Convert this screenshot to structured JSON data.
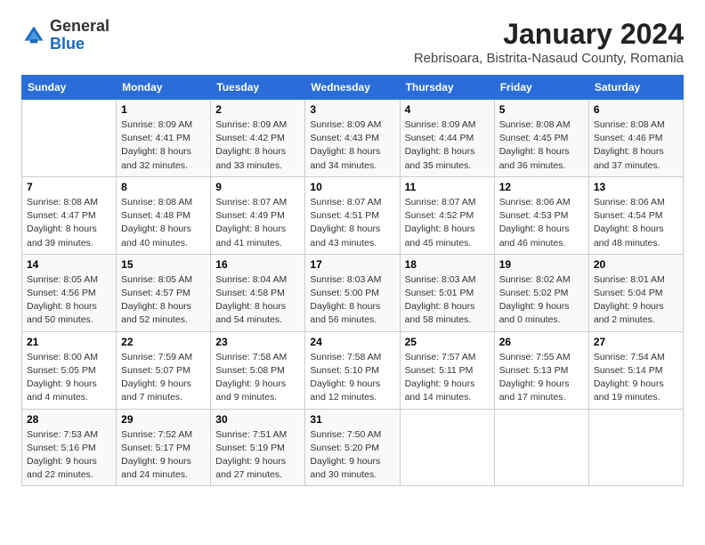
{
  "logo": {
    "text_general": "General",
    "text_blue": "Blue"
  },
  "title": "January 2024",
  "subtitle": "Rebrisoara, Bistrita-Nasaud County, Romania",
  "days_of_week": [
    "Sunday",
    "Monday",
    "Tuesday",
    "Wednesday",
    "Thursday",
    "Friday",
    "Saturday"
  ],
  "weeks": [
    [
      {
        "num": "",
        "info": ""
      },
      {
        "num": "1",
        "info": "Sunrise: 8:09 AM\nSunset: 4:41 PM\nDaylight: 8 hours\nand 32 minutes."
      },
      {
        "num": "2",
        "info": "Sunrise: 8:09 AM\nSunset: 4:42 PM\nDaylight: 8 hours\nand 33 minutes."
      },
      {
        "num": "3",
        "info": "Sunrise: 8:09 AM\nSunset: 4:43 PM\nDaylight: 8 hours\nand 34 minutes."
      },
      {
        "num": "4",
        "info": "Sunrise: 8:09 AM\nSunset: 4:44 PM\nDaylight: 8 hours\nand 35 minutes."
      },
      {
        "num": "5",
        "info": "Sunrise: 8:08 AM\nSunset: 4:45 PM\nDaylight: 8 hours\nand 36 minutes."
      },
      {
        "num": "6",
        "info": "Sunrise: 8:08 AM\nSunset: 4:46 PM\nDaylight: 8 hours\nand 37 minutes."
      }
    ],
    [
      {
        "num": "7",
        "info": "Sunrise: 8:08 AM\nSunset: 4:47 PM\nDaylight: 8 hours\nand 39 minutes."
      },
      {
        "num": "8",
        "info": "Sunrise: 8:08 AM\nSunset: 4:48 PM\nDaylight: 8 hours\nand 40 minutes."
      },
      {
        "num": "9",
        "info": "Sunrise: 8:07 AM\nSunset: 4:49 PM\nDaylight: 8 hours\nand 41 minutes."
      },
      {
        "num": "10",
        "info": "Sunrise: 8:07 AM\nSunset: 4:51 PM\nDaylight: 8 hours\nand 43 minutes."
      },
      {
        "num": "11",
        "info": "Sunrise: 8:07 AM\nSunset: 4:52 PM\nDaylight: 8 hours\nand 45 minutes."
      },
      {
        "num": "12",
        "info": "Sunrise: 8:06 AM\nSunset: 4:53 PM\nDaylight: 8 hours\nand 46 minutes."
      },
      {
        "num": "13",
        "info": "Sunrise: 8:06 AM\nSunset: 4:54 PM\nDaylight: 8 hours\nand 48 minutes."
      }
    ],
    [
      {
        "num": "14",
        "info": "Sunrise: 8:05 AM\nSunset: 4:56 PM\nDaylight: 8 hours\nand 50 minutes."
      },
      {
        "num": "15",
        "info": "Sunrise: 8:05 AM\nSunset: 4:57 PM\nDaylight: 8 hours\nand 52 minutes."
      },
      {
        "num": "16",
        "info": "Sunrise: 8:04 AM\nSunset: 4:58 PM\nDaylight: 8 hours\nand 54 minutes."
      },
      {
        "num": "17",
        "info": "Sunrise: 8:03 AM\nSunset: 5:00 PM\nDaylight: 8 hours\nand 56 minutes."
      },
      {
        "num": "18",
        "info": "Sunrise: 8:03 AM\nSunset: 5:01 PM\nDaylight: 8 hours\nand 58 minutes."
      },
      {
        "num": "19",
        "info": "Sunrise: 8:02 AM\nSunset: 5:02 PM\nDaylight: 9 hours\nand 0 minutes."
      },
      {
        "num": "20",
        "info": "Sunrise: 8:01 AM\nSunset: 5:04 PM\nDaylight: 9 hours\nand 2 minutes."
      }
    ],
    [
      {
        "num": "21",
        "info": "Sunrise: 8:00 AM\nSunset: 5:05 PM\nDaylight: 9 hours\nand 4 minutes."
      },
      {
        "num": "22",
        "info": "Sunrise: 7:59 AM\nSunset: 5:07 PM\nDaylight: 9 hours\nand 7 minutes."
      },
      {
        "num": "23",
        "info": "Sunrise: 7:58 AM\nSunset: 5:08 PM\nDaylight: 9 hours\nand 9 minutes."
      },
      {
        "num": "24",
        "info": "Sunrise: 7:58 AM\nSunset: 5:10 PM\nDaylight: 9 hours\nand 12 minutes."
      },
      {
        "num": "25",
        "info": "Sunrise: 7:57 AM\nSunset: 5:11 PM\nDaylight: 9 hours\nand 14 minutes."
      },
      {
        "num": "26",
        "info": "Sunrise: 7:55 AM\nSunset: 5:13 PM\nDaylight: 9 hours\nand 17 minutes."
      },
      {
        "num": "27",
        "info": "Sunrise: 7:54 AM\nSunset: 5:14 PM\nDaylight: 9 hours\nand 19 minutes."
      }
    ],
    [
      {
        "num": "28",
        "info": "Sunrise: 7:53 AM\nSunset: 5:16 PM\nDaylight: 9 hours\nand 22 minutes."
      },
      {
        "num": "29",
        "info": "Sunrise: 7:52 AM\nSunset: 5:17 PM\nDaylight: 9 hours\nand 24 minutes."
      },
      {
        "num": "30",
        "info": "Sunrise: 7:51 AM\nSunset: 5:19 PM\nDaylight: 9 hours\nand 27 minutes."
      },
      {
        "num": "31",
        "info": "Sunrise: 7:50 AM\nSunset: 5:20 PM\nDaylight: 9 hours\nand 30 minutes."
      },
      {
        "num": "",
        "info": ""
      },
      {
        "num": "",
        "info": ""
      },
      {
        "num": "",
        "info": ""
      }
    ]
  ]
}
